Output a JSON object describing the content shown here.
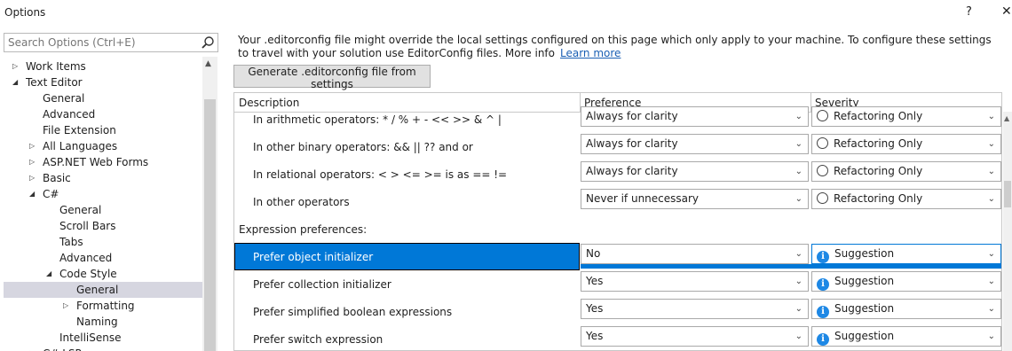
{
  "window": {
    "title": "Options",
    "help_label": "?",
    "close_label": "✕"
  },
  "search": {
    "placeholder": "Search Options (Ctrl+E)",
    "value": ""
  },
  "tree": [
    {
      "label": "Work Items",
      "arrow": "▷",
      "indent": 0,
      "selected": false
    },
    {
      "label": "Text Editor",
      "arrow": "◢",
      "indent": 0,
      "selected": false
    },
    {
      "label": "General",
      "arrow": "",
      "indent": 1,
      "selected": false
    },
    {
      "label": "Advanced",
      "arrow": "",
      "indent": 1,
      "selected": false
    },
    {
      "label": "File Extension",
      "arrow": "",
      "indent": 1,
      "selected": false
    },
    {
      "label": "All Languages",
      "arrow": "▷",
      "indent": 1,
      "selected": false
    },
    {
      "label": "ASP.NET Web Forms",
      "arrow": "▷",
      "indent": 1,
      "selected": false
    },
    {
      "label": "Basic",
      "arrow": "▷",
      "indent": 1,
      "selected": false
    },
    {
      "label": "C#",
      "arrow": "◢",
      "indent": 1,
      "selected": false
    },
    {
      "label": "General",
      "arrow": "",
      "indent": 2,
      "selected": false
    },
    {
      "label": "Scroll Bars",
      "arrow": "",
      "indent": 2,
      "selected": false
    },
    {
      "label": "Tabs",
      "arrow": "",
      "indent": 2,
      "selected": false
    },
    {
      "label": "Advanced",
      "arrow": "",
      "indent": 2,
      "selected": false
    },
    {
      "label": "Code Style",
      "arrow": "◢",
      "indent": 2,
      "selected": false
    },
    {
      "label": "General",
      "arrow": "",
      "indent": 3,
      "selected": true
    },
    {
      "label": "Formatting",
      "arrow": "▷",
      "indent": 3,
      "selected": false
    },
    {
      "label": "Naming",
      "arrow": "",
      "indent": 3,
      "selected": false
    },
    {
      "label": "IntelliSense",
      "arrow": "",
      "indent": 2,
      "selected": false
    },
    {
      "label": "C# LSP",
      "arrow": "▷",
      "indent": 1,
      "selected": false
    }
  ],
  "info": {
    "text": "Your .editorconfig file might override the local settings configured on this page which only apply to your machine. To configure these settings to travel with your solution use EditorConfig files. More info",
    "link": "Learn more"
  },
  "generate_button": "Generate .editorconfig file from settings",
  "grid": {
    "headers": {
      "description": "Description",
      "preference": "Preference",
      "severity": "Severity"
    },
    "rows": [
      {
        "kind": "item",
        "description": "In arithmetic operators:  *  /  %  +  -  <<  >>  &  ^  |",
        "preference": "Always for clarity",
        "severity": "Refactoring Only",
        "severity_icon": "radio",
        "selected": false
      },
      {
        "kind": "item",
        "description": "In other binary operators:  &&  ||  ??  and  or",
        "preference": "Always for clarity",
        "severity": "Refactoring Only",
        "severity_icon": "radio",
        "selected": false
      },
      {
        "kind": "item",
        "description": "In relational operators:  <  >  <=  >=  is  as  ==  !=",
        "preference": "Always for clarity",
        "severity": "Refactoring Only",
        "severity_icon": "radio",
        "selected": false
      },
      {
        "kind": "item",
        "description": "In other operators",
        "preference": "Never if unnecessary",
        "severity": "Refactoring Only",
        "severity_icon": "radio",
        "selected": false
      },
      {
        "kind": "section",
        "description": "Expression preferences:"
      },
      {
        "kind": "item",
        "description": "Prefer object initializer",
        "preference": "No",
        "severity": "Suggestion",
        "severity_icon": "info",
        "selected": true
      },
      {
        "kind": "item",
        "description": "Prefer collection initializer",
        "preference": "Yes",
        "severity": "Suggestion",
        "severity_icon": "info",
        "selected": false
      },
      {
        "kind": "item",
        "description": "Prefer simplified boolean expressions",
        "preference": "Yes",
        "severity": "Suggestion",
        "severity_icon": "info",
        "selected": false
      },
      {
        "kind": "item",
        "description": "Prefer switch expression",
        "preference": "Yes",
        "severity": "Suggestion",
        "severity_icon": "info",
        "selected": false
      }
    ]
  },
  "colors": {
    "selection": "#0078d7",
    "tree_selection": "#d6d6e0",
    "link": "#1a5fb4"
  }
}
